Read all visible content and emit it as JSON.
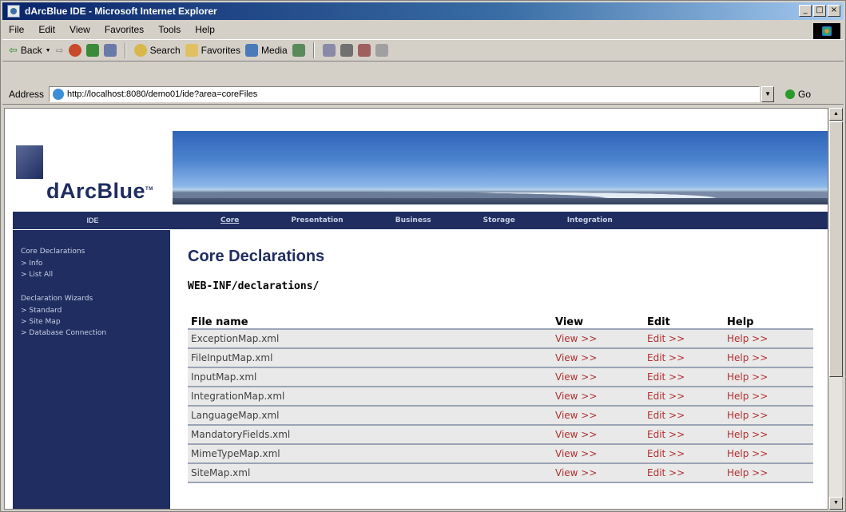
{
  "window": {
    "title": "dArcBlue IDE - Microsoft Internet Explorer",
    "controls": [
      "_",
      "□",
      "×"
    ]
  },
  "menu": {
    "items": [
      "File",
      "Edit",
      "View",
      "Favorites",
      "Tools",
      "Help"
    ]
  },
  "toolbar": {
    "back": "Back",
    "search": "Search",
    "favorites": "Favorites",
    "media": "Media"
  },
  "address": {
    "label": "Address",
    "url": "http://localhost:8080/demo01/ide?area=coreFiles",
    "go": "Go"
  },
  "site": {
    "logo": "dArcBlue",
    "logo_tm": "TM",
    "nav": {
      "home": "IDE",
      "items": [
        "Core",
        "Presentation",
        "Business",
        "Storage",
        "Integration"
      ],
      "active": "Core"
    }
  },
  "sidebar": {
    "sections": [
      {
        "heading": "Core Declarations",
        "links": [
          "> Info",
          "> List All"
        ]
      },
      {
        "heading": "Declaration Wizards",
        "links": [
          "> Standard",
          "> Site Map",
          "> Database Connection"
        ]
      }
    ]
  },
  "main": {
    "title": "Core Declarations",
    "path": "WEB-INF/declarations/",
    "columns": [
      "File name",
      "View",
      "Edit",
      "Help"
    ],
    "link_labels": {
      "view": "View >>",
      "edit": "Edit >>",
      "help": "Help >>"
    },
    "rows": [
      "ExceptionMap.xml",
      "FileInputMap.xml",
      "InputMap.xml",
      "IntegrationMap.xml",
      "LanguageMap.xml",
      "MandatoryFields.xml",
      "MimeTypeMap.xml",
      "SiteMap.xml"
    ]
  },
  "colors": {
    "brand_navy": "#1f2d60",
    "link_red": "#b0302f"
  }
}
